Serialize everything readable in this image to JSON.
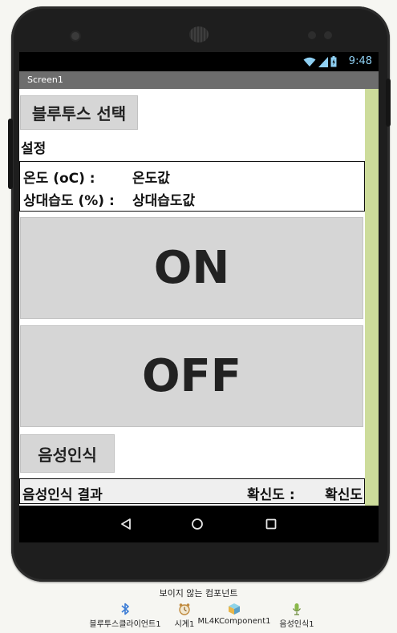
{
  "statusbar": {
    "time": "9:48"
  },
  "titlebar": {
    "title": "Screen1"
  },
  "buttons": {
    "bluetooth": "블루투스 선택",
    "on": "ON",
    "off": "OFF",
    "voice": "음성인식"
  },
  "settings": {
    "label": "설정"
  },
  "sensor": {
    "temp_label": "온도 (oC) :",
    "temp_value": "온도값",
    "humidity_label": "상대습도 (%) :",
    "humidity_value": "상대습도값"
  },
  "result": {
    "label": "음성인식 결과",
    "confidence_label": "확신도 :",
    "confidence_value": "확신도"
  },
  "nonvisible": {
    "title": "보이지 않는 컴포넌트",
    "components": [
      {
        "label": "블루투스클라이언트1",
        "icon": "bluetooth-icon"
      },
      {
        "label": "시계1",
        "icon": "clock-icon"
      },
      {
        "label": "ML4KComponent1",
        "icon": "cube-icon"
      },
      {
        "label": "음성인식1",
        "icon": "microphone-icon"
      }
    ]
  },
  "colors": {
    "scroll_rail": "#cddc9b",
    "button_bg": "#d6d6d6",
    "status_accent": "#8fd0f3"
  }
}
